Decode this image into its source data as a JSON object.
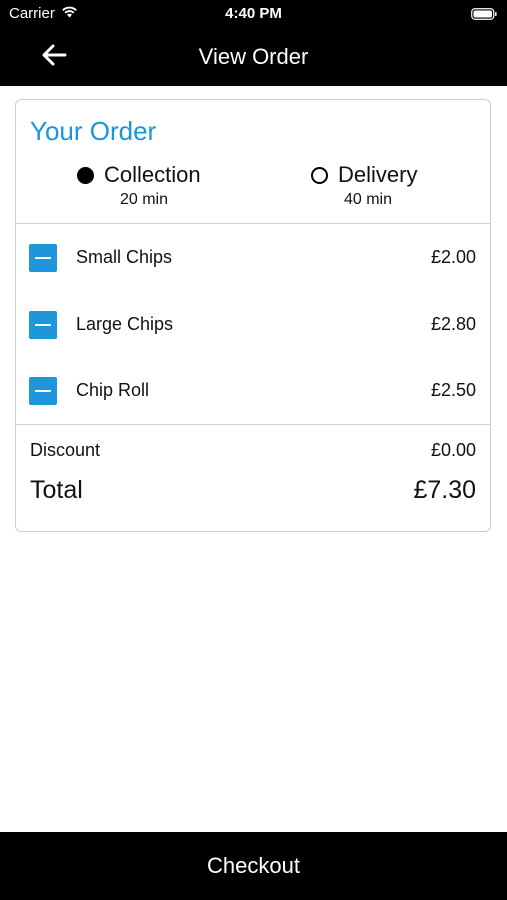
{
  "status_bar": {
    "carrier": "Carrier",
    "time": "4:40 PM",
    "icons": [
      "wifi-icon",
      "battery-icon"
    ]
  },
  "nav": {
    "title": "View Order",
    "back_icon": "arrow-left-icon"
  },
  "order": {
    "title": "Your Order",
    "title_color": "#1a95dc",
    "options": [
      {
        "label": "Collection",
        "time": "20 min",
        "selected": true
      },
      {
        "label": "Delivery",
        "time": "40 min",
        "selected": false
      }
    ],
    "items": [
      {
        "name": "Small Chips",
        "price": "£2.00",
        "icon": "minus-icon"
      },
      {
        "name": "Large Chips",
        "price": "£2.80",
        "icon": "minus-icon"
      },
      {
        "name": "Chip Roll",
        "price": "£2.50",
        "icon": "minus-icon"
      }
    ],
    "remove_button_color": "#1f95dc",
    "discount_label": "Discount",
    "discount_value": "£0.00",
    "total_label": "Total",
    "total_value": "£7.30"
  },
  "checkout": {
    "label": "Checkout"
  }
}
